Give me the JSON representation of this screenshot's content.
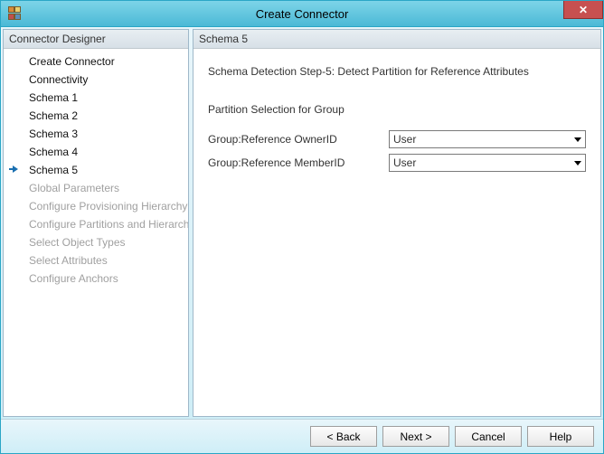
{
  "window": {
    "title": "Create Connector"
  },
  "left_panel": {
    "header": "Connector Designer",
    "items": [
      {
        "label": "Create Connector",
        "state": "enabled"
      },
      {
        "label": "Connectivity",
        "state": "enabled"
      },
      {
        "label": "Schema 1",
        "state": "enabled"
      },
      {
        "label": "Schema 2",
        "state": "enabled"
      },
      {
        "label": "Schema 3",
        "state": "enabled"
      },
      {
        "label": "Schema 4",
        "state": "enabled"
      },
      {
        "label": "Schema 5",
        "state": "current"
      },
      {
        "label": "Global Parameters",
        "state": "disabled"
      },
      {
        "label": "Configure Provisioning Hierarchy",
        "state": "disabled"
      },
      {
        "label": "Configure Partitions and Hierarchies",
        "state": "disabled"
      },
      {
        "label": "Select Object Types",
        "state": "disabled"
      },
      {
        "label": "Select Attributes",
        "state": "disabled"
      },
      {
        "label": "Configure Anchors",
        "state": "disabled"
      }
    ]
  },
  "right_panel": {
    "header": "Schema 5",
    "step_title": "Schema Detection Step-5: Detect Partition for Reference Attributes",
    "section_title": "Partition Selection for Group",
    "rows": [
      {
        "label": "Group:Reference OwnerID",
        "value": "User"
      },
      {
        "label": "Group:Reference MemberID",
        "value": "User"
      }
    ]
  },
  "footer": {
    "back": "<  Back",
    "next": "Next  >",
    "cancel": "Cancel",
    "help": "Help"
  }
}
